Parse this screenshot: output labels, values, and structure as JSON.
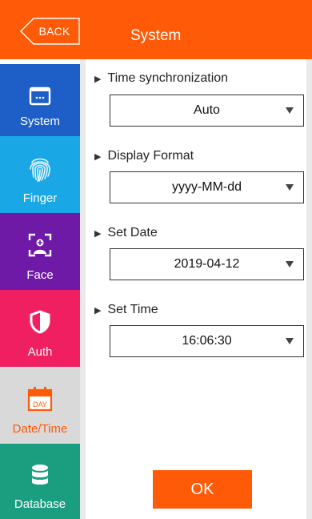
{
  "header": {
    "back_label": "BACK",
    "title": "System"
  },
  "sidebar": {
    "items": [
      {
        "label": "System",
        "icon": "window-icon"
      },
      {
        "label": "Finger",
        "icon": "fingerprint-icon"
      },
      {
        "label": "Face",
        "icon": "face-scan-icon"
      },
      {
        "label": "Auth",
        "icon": "shield-icon"
      },
      {
        "label": "Date/Time",
        "icon": "calendar-day-icon",
        "badge": "DAY",
        "selected": true
      },
      {
        "label": "Database",
        "icon": "database-icon"
      }
    ]
  },
  "settings": [
    {
      "label": "Time synchronization",
      "value": "Auto"
    },
    {
      "label": "Display Format",
      "value": "yyyy-MM-dd"
    },
    {
      "label": "Set Date",
      "value": "2019-04-12"
    },
    {
      "label": "Set Time",
      "value": "16:06:30"
    }
  ],
  "ok_label": "OK",
  "colors": {
    "accent": "#fe5a08",
    "system": "#1d5fc6",
    "finger": "#1aa7e6",
    "face": "#6f1aa6",
    "auth": "#ef1f61",
    "datetime": "#d9d9d9",
    "database": "#1b9d80"
  }
}
